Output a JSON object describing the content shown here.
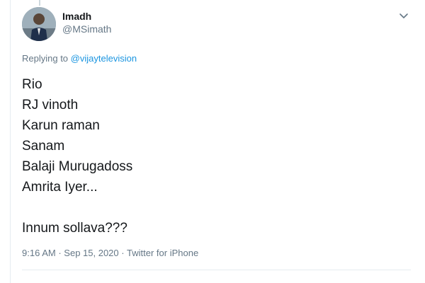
{
  "author": {
    "display_name": "Imadh",
    "handle": "@MSimath"
  },
  "reply": {
    "prefix": "Replying to",
    "mention": "@vijaytelevision"
  },
  "tweet": {
    "lines": [
      "Rio",
      "RJ vinoth",
      "Karun raman",
      "Sanam",
      "Balaji Murugadoss",
      "Amrita Iyer...",
      "",
      "Innum sollava???"
    ]
  },
  "meta": {
    "time": "9:16 AM",
    "separator": "·",
    "date": "Sep 15, 2020",
    "source": "Twitter for iPhone"
  },
  "icons": {
    "more": "chevron-down-icon",
    "avatar": "avatar"
  },
  "colors": {
    "link": "#1b95e0",
    "secondary_text": "#657786",
    "primary_text": "#14171a"
  }
}
